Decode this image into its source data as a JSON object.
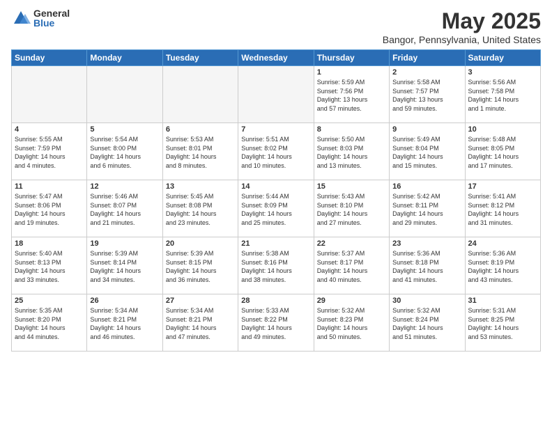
{
  "header": {
    "logo_general": "General",
    "logo_blue": "Blue",
    "title": "May 2025",
    "subtitle": "Bangor, Pennsylvania, United States"
  },
  "days_of_week": [
    "Sunday",
    "Monday",
    "Tuesday",
    "Wednesday",
    "Thursday",
    "Friday",
    "Saturday"
  ],
  "weeks": [
    [
      {
        "day": "",
        "info": ""
      },
      {
        "day": "",
        "info": ""
      },
      {
        "day": "",
        "info": ""
      },
      {
        "day": "",
        "info": ""
      },
      {
        "day": "1",
        "info": "Sunrise: 5:59 AM\nSunset: 7:56 PM\nDaylight: 13 hours\nand 57 minutes."
      },
      {
        "day": "2",
        "info": "Sunrise: 5:58 AM\nSunset: 7:57 PM\nDaylight: 13 hours\nand 59 minutes."
      },
      {
        "day": "3",
        "info": "Sunrise: 5:56 AM\nSunset: 7:58 PM\nDaylight: 14 hours\nand 1 minute."
      }
    ],
    [
      {
        "day": "4",
        "info": "Sunrise: 5:55 AM\nSunset: 7:59 PM\nDaylight: 14 hours\nand 4 minutes."
      },
      {
        "day": "5",
        "info": "Sunrise: 5:54 AM\nSunset: 8:00 PM\nDaylight: 14 hours\nand 6 minutes."
      },
      {
        "day": "6",
        "info": "Sunrise: 5:53 AM\nSunset: 8:01 PM\nDaylight: 14 hours\nand 8 minutes."
      },
      {
        "day": "7",
        "info": "Sunrise: 5:51 AM\nSunset: 8:02 PM\nDaylight: 14 hours\nand 10 minutes."
      },
      {
        "day": "8",
        "info": "Sunrise: 5:50 AM\nSunset: 8:03 PM\nDaylight: 14 hours\nand 13 minutes."
      },
      {
        "day": "9",
        "info": "Sunrise: 5:49 AM\nSunset: 8:04 PM\nDaylight: 14 hours\nand 15 minutes."
      },
      {
        "day": "10",
        "info": "Sunrise: 5:48 AM\nSunset: 8:05 PM\nDaylight: 14 hours\nand 17 minutes."
      }
    ],
    [
      {
        "day": "11",
        "info": "Sunrise: 5:47 AM\nSunset: 8:06 PM\nDaylight: 14 hours\nand 19 minutes."
      },
      {
        "day": "12",
        "info": "Sunrise: 5:46 AM\nSunset: 8:07 PM\nDaylight: 14 hours\nand 21 minutes."
      },
      {
        "day": "13",
        "info": "Sunrise: 5:45 AM\nSunset: 8:08 PM\nDaylight: 14 hours\nand 23 minutes."
      },
      {
        "day": "14",
        "info": "Sunrise: 5:44 AM\nSunset: 8:09 PM\nDaylight: 14 hours\nand 25 minutes."
      },
      {
        "day": "15",
        "info": "Sunrise: 5:43 AM\nSunset: 8:10 PM\nDaylight: 14 hours\nand 27 minutes."
      },
      {
        "day": "16",
        "info": "Sunrise: 5:42 AM\nSunset: 8:11 PM\nDaylight: 14 hours\nand 29 minutes."
      },
      {
        "day": "17",
        "info": "Sunrise: 5:41 AM\nSunset: 8:12 PM\nDaylight: 14 hours\nand 31 minutes."
      }
    ],
    [
      {
        "day": "18",
        "info": "Sunrise: 5:40 AM\nSunset: 8:13 PM\nDaylight: 14 hours\nand 33 minutes."
      },
      {
        "day": "19",
        "info": "Sunrise: 5:39 AM\nSunset: 8:14 PM\nDaylight: 14 hours\nand 34 minutes."
      },
      {
        "day": "20",
        "info": "Sunrise: 5:39 AM\nSunset: 8:15 PM\nDaylight: 14 hours\nand 36 minutes."
      },
      {
        "day": "21",
        "info": "Sunrise: 5:38 AM\nSunset: 8:16 PM\nDaylight: 14 hours\nand 38 minutes."
      },
      {
        "day": "22",
        "info": "Sunrise: 5:37 AM\nSunset: 8:17 PM\nDaylight: 14 hours\nand 40 minutes."
      },
      {
        "day": "23",
        "info": "Sunrise: 5:36 AM\nSunset: 8:18 PM\nDaylight: 14 hours\nand 41 minutes."
      },
      {
        "day": "24",
        "info": "Sunrise: 5:36 AM\nSunset: 8:19 PM\nDaylight: 14 hours\nand 43 minutes."
      }
    ],
    [
      {
        "day": "25",
        "info": "Sunrise: 5:35 AM\nSunset: 8:20 PM\nDaylight: 14 hours\nand 44 minutes."
      },
      {
        "day": "26",
        "info": "Sunrise: 5:34 AM\nSunset: 8:21 PM\nDaylight: 14 hours\nand 46 minutes."
      },
      {
        "day": "27",
        "info": "Sunrise: 5:34 AM\nSunset: 8:21 PM\nDaylight: 14 hours\nand 47 minutes."
      },
      {
        "day": "28",
        "info": "Sunrise: 5:33 AM\nSunset: 8:22 PM\nDaylight: 14 hours\nand 49 minutes."
      },
      {
        "day": "29",
        "info": "Sunrise: 5:32 AM\nSunset: 8:23 PM\nDaylight: 14 hours\nand 50 minutes."
      },
      {
        "day": "30",
        "info": "Sunrise: 5:32 AM\nSunset: 8:24 PM\nDaylight: 14 hours\nand 51 minutes."
      },
      {
        "day": "31",
        "info": "Sunrise: 5:31 AM\nSunset: 8:25 PM\nDaylight: 14 hours\nand 53 minutes."
      }
    ]
  ]
}
